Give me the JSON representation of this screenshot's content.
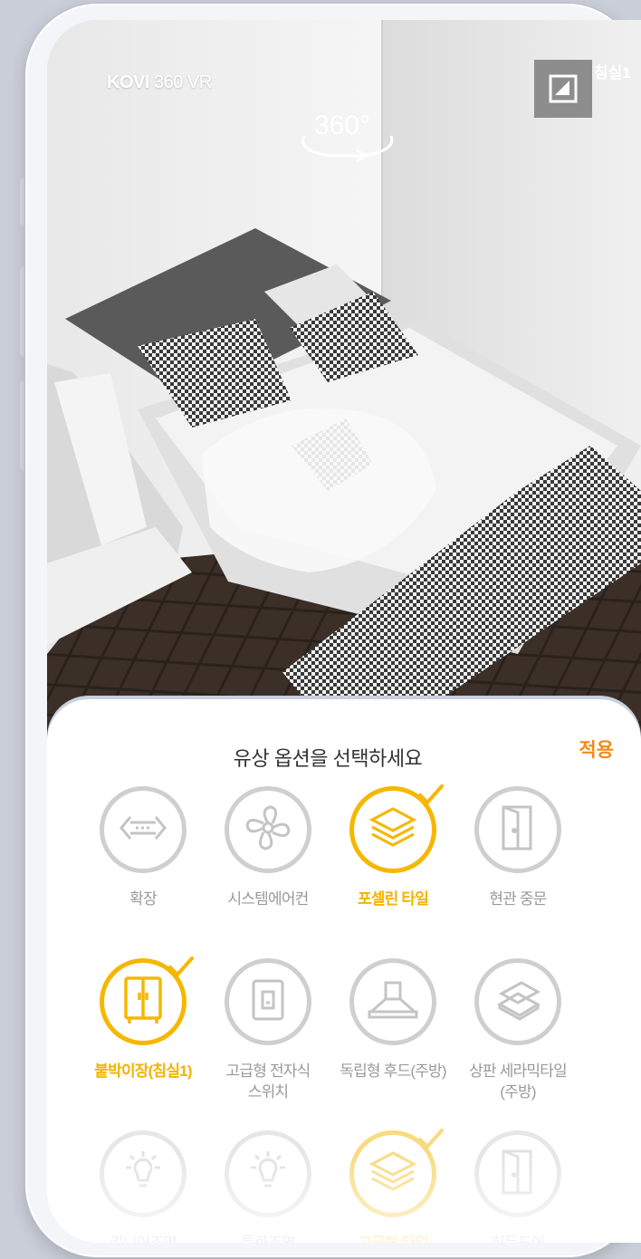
{
  "brand": {
    "name": "KOVI",
    "suffix": "360 VR"
  },
  "badge": {
    "text": "360°"
  },
  "room_tag": "침실1",
  "sheet": {
    "title": "유상 옵션을 선택하세요",
    "apply_label": "적용"
  },
  "options": [
    {
      "label": "확장",
      "icon": "expand-arrows-icon",
      "selected": false
    },
    {
      "label": "시스템에어컨",
      "icon": "fan-icon",
      "selected": false
    },
    {
      "label": "포셀린 타일",
      "icon": "tile-layers-icon",
      "selected": true
    },
    {
      "label": "현관 중문",
      "icon": "door-icon",
      "selected": false
    },
    {
      "label": "붙박이장(침실1)",
      "icon": "wardrobe-icon",
      "selected": true
    },
    {
      "label": "고급형 전자식\n스위치",
      "icon": "switch-icon",
      "selected": false
    },
    {
      "label": "독립형 후드(주방)",
      "icon": "range-hood-icon",
      "selected": false
    },
    {
      "label": "상판 세라믹타일\n(주방)",
      "icon": "ceramic-tile-icon",
      "selected": false
    },
    {
      "label": "리니어조명",
      "icon": "bulb-icon",
      "selected": false
    },
    {
      "label": "특화조명",
      "icon": "bulb-icon",
      "selected": false
    },
    {
      "label": "고급형 타일",
      "icon": "tile-layers-icon",
      "selected": true
    },
    {
      "label": "히든도어",
      "icon": "door-icon",
      "selected": false
    }
  ],
  "colors": {
    "accent": "#f5b700",
    "apply": "#f28a1d",
    "inactive": "#cfcfcf"
  }
}
